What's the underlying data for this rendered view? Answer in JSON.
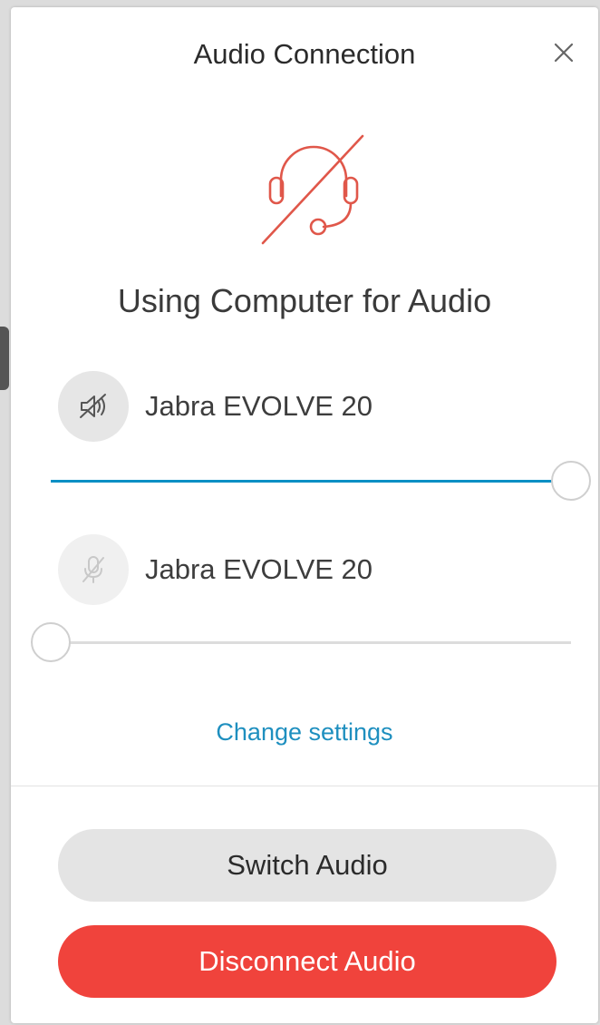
{
  "dialog": {
    "title": "Audio Connection",
    "close_icon": "close-icon",
    "hero_icon": "headset-off-icon",
    "status_text": "Using Computer for Audio"
  },
  "speaker": {
    "icon": "speaker-muted-icon",
    "device_name": "Jabra EVOLVE 20",
    "volume_percent": 100
  },
  "microphone": {
    "icon": "microphone-muted-icon",
    "device_name": "Jabra EVOLVE 20",
    "volume_percent": 0
  },
  "links": {
    "change_settings": "Change settings"
  },
  "buttons": {
    "switch_audio": "Switch Audio",
    "disconnect_audio": "Disconnect Audio"
  },
  "colors": {
    "accent_blue": "#0a8fc4",
    "link_blue": "#1e8fbf",
    "danger_red": "#f0433c",
    "hero_icon_red": "#e0574a"
  }
}
